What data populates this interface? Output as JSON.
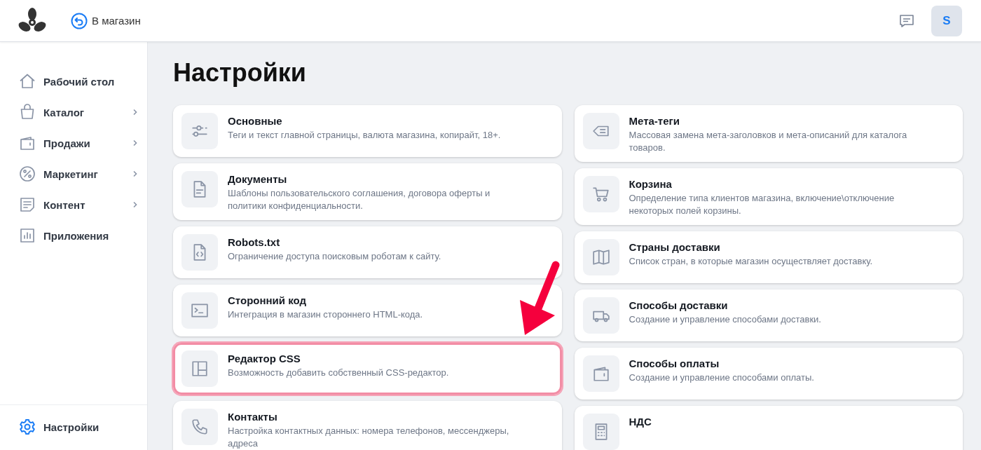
{
  "header": {
    "back_link": "В магазин",
    "avatar": "S"
  },
  "sidebar": {
    "items": [
      {
        "label": "Рабочий стол",
        "expandable": false,
        "selected": false
      },
      {
        "label": "Каталог",
        "expandable": true,
        "selected": false
      },
      {
        "label": "Продажи",
        "expandable": true,
        "selected": false
      },
      {
        "label": "Маркетинг",
        "expandable": true,
        "selected": false
      },
      {
        "label": "Контент",
        "expandable": true,
        "selected": false
      },
      {
        "label": "Приложения",
        "expandable": false,
        "selected": false
      }
    ],
    "footer_item": {
      "label": "Настройки",
      "selected": true
    }
  },
  "page_title": "Настройки",
  "columns": [
    [
      {
        "title": "Основные",
        "description": "Теги и текст главной страницы, валюта магазина, копирайт, 18+.",
        "highlighted": false
      },
      {
        "title": "Документы",
        "description": "Шаблоны пользовательского соглашения, договора оферты и политики конфиденциальности.",
        "highlighted": false
      },
      {
        "title": "Robots.txt",
        "description": "Ограничение доступа поисковым роботам к сайту.",
        "highlighted": false
      },
      {
        "title": "Сторонний код",
        "description": "Интеграция в магазин стороннего HTML-кода.",
        "highlighted": false
      },
      {
        "title": "Редактор CSS",
        "description": "Возможность добавить собственный CSS-редактор.",
        "highlighted": true
      },
      {
        "title": "Контакты",
        "description": "Настройка контактных данных: номера телефонов, мессенджеры, адреса",
        "highlighted": false
      }
    ],
    [
      {
        "title": "Мета-теги",
        "description": "Массовая замена мета-заголовков и мета-описаний для каталога товаров.",
        "highlighted": false
      },
      {
        "title": "Корзина",
        "description": "Определение типа клиентов магазина, включение\\отключение некоторых полей корзины.",
        "highlighted": false
      },
      {
        "title": "Страны доставки",
        "description": "Список стран, в которые магазин осуществляет доставку.",
        "highlighted": false
      },
      {
        "title": "Способы доставки",
        "description": "Создание и управление способами доставки.",
        "highlighted": false
      },
      {
        "title": "Способы оплаты",
        "description": "Создание и управление способами оплаты.",
        "highlighted": false
      },
      {
        "title": "НДС",
        "highlighted": false
      }
    ]
  ]
}
